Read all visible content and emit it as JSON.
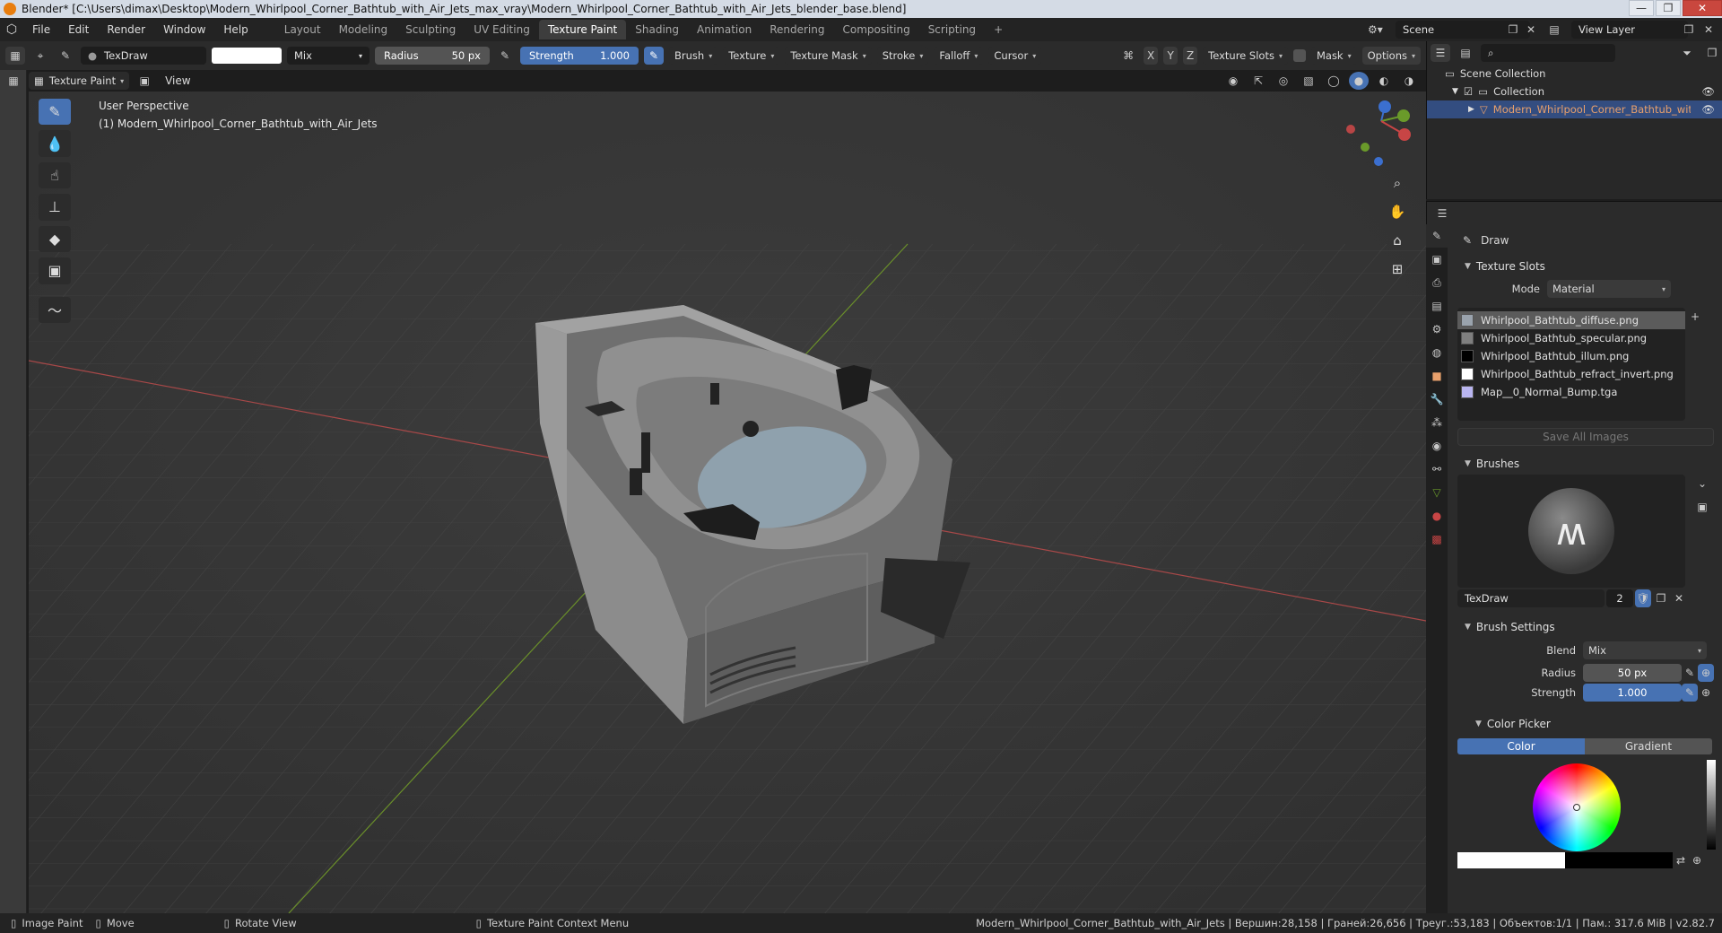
{
  "titlebar": {
    "title": "Blender* [C:\\Users\\dimax\\Desktop\\Modern_Whirlpool_Corner_Bathtub_with_Air_Jets_max_vray\\Modern_Whirlpool_Corner_Bathtub_with_Air_Jets_blender_base.blend]",
    "minimize": "—",
    "maximize": "❐",
    "close": "✕"
  },
  "menu": {
    "items": [
      "File",
      "Edit",
      "Render",
      "Window",
      "Help"
    ],
    "workspaces": [
      "Layout",
      "Modeling",
      "Sculpting",
      "UV Editing",
      "Texture Paint",
      "Shading",
      "Animation",
      "Rendering",
      "Compositing",
      "Scripting"
    ],
    "active_workspace": "Texture Paint",
    "add_workspace": "+",
    "scene_label": "Scene",
    "view_layer_label": "View Layer"
  },
  "header1": {
    "brush_name": "TexDraw",
    "blend_mode": "Mix",
    "radius_label": "Radius",
    "radius_value": "50 px",
    "strength_label": "Strength",
    "strength_value": "1.000",
    "dropdowns": [
      "Brush",
      "Texture",
      "Texture Mask",
      "Stroke",
      "Falloff",
      "Cursor"
    ],
    "axis_x": "X",
    "axis_y": "Y",
    "axis_z": "Z",
    "texture_slots": "Texture Slots",
    "mask": "Mask",
    "options": "Options"
  },
  "header2": {
    "mode": "Texture Paint",
    "view": "View"
  },
  "viewport": {
    "perspective": "User Perspective",
    "object_info": "(1) Modern_Whirlpool_Corner_Bathtub_with_Air_Jets"
  },
  "outliner": {
    "scene_collection": "Scene Collection",
    "collection": "Collection",
    "object": "Modern_Whirlpool_Corner_Bathtub_with_Air"
  },
  "properties": {
    "tool_name": "Draw",
    "texture_slots_title": "Texture Slots",
    "mode_label": "Mode",
    "mode_value": "Material",
    "slots": [
      {
        "name": "Whirlpool_Bathtub_diffuse.png",
        "color": "#9aa3ad"
      },
      {
        "name": "Whirlpool_Bathtub_specular.png",
        "color": "#7f7f7f"
      },
      {
        "name": "Whirlpool_Bathtub_illum.png",
        "color": "#000000"
      },
      {
        "name": "Whirlpool_Bathtub_refract_invert.png",
        "color": "#ffffff"
      },
      {
        "name": "Map__0_Normal_Bump.tga",
        "color": "#b9b5f0"
      }
    ],
    "save_all_images": "Save All Images",
    "brushes_title": "Brushes",
    "brush_name": "TexDraw",
    "brush_users": "2",
    "brush_settings_title": "Brush Settings",
    "blend_label": "Blend",
    "blend_value": "Mix",
    "radius_label": "Radius",
    "radius_value": "50 px",
    "strength_label": "Strength",
    "strength_value": "1.000",
    "color_picker_title": "Color Picker",
    "color_tab": "Color",
    "gradient_tab": "Gradient"
  },
  "statusbar": {
    "left1": "Image Paint",
    "left2": "Move",
    "left3": "Rotate View",
    "left4": "Texture Paint Context Menu",
    "right": "Modern_Whirlpool_Corner_Bathtub_with_Air_Jets | Вершин:28,158 | Граней:26,656 | Треуг.:53,183 | Объектов:1/1 | Пам.: 317.6 MiB | v2.82.7"
  },
  "colors": {
    "accent": "#4772b3",
    "selected_row": "#334d80",
    "object_orange": "#e8a06c",
    "axis_red": "#c84545",
    "axis_green": "#6a9a2a"
  }
}
